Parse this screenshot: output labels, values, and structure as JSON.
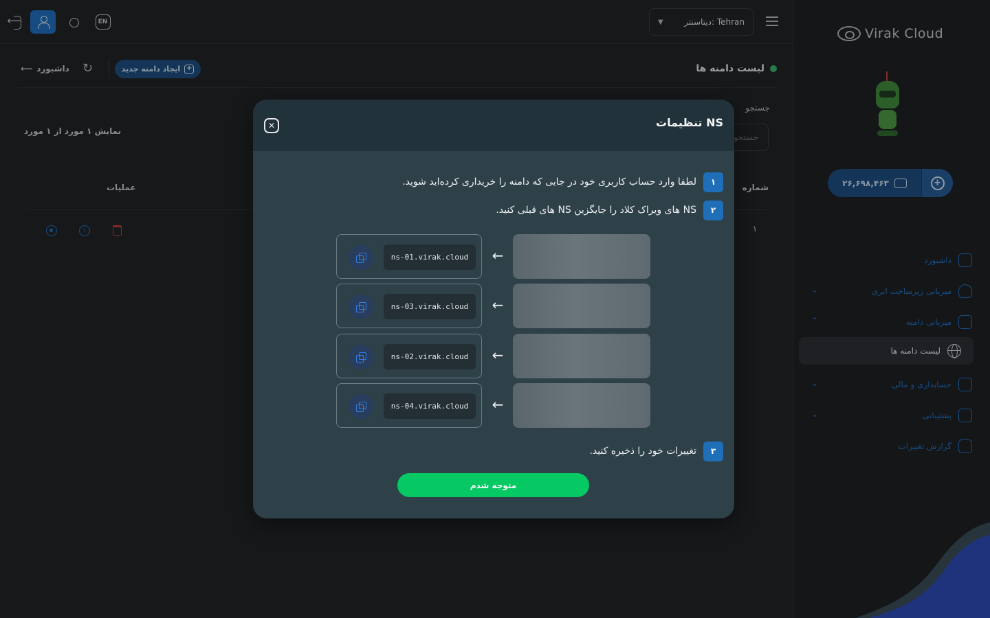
{
  "brand": {
    "name": "Virak Cloud"
  },
  "wallet": {
    "balance": "۲۶,۶۹۸,۴۶۳"
  },
  "sidebar": {
    "items": [
      {
        "label": "داشبورد",
        "icon": "home-icon",
        "expandable": false
      },
      {
        "label": "میزبانی زیرساخت ابری",
        "icon": "cloud-icon",
        "expandable": true
      },
      {
        "label": "میزبانی دامنه",
        "icon": "server-icon",
        "expandable": true,
        "expanded": true
      },
      {
        "label": "حسابداری و مالی",
        "icon": "wallet-icon",
        "expandable": true
      },
      {
        "label": "پشتیبانی",
        "icon": "support-icon",
        "expandable": true
      },
      {
        "label": "گزارش تغییرات",
        "icon": "report-icon",
        "expandable": false
      }
    ],
    "active_sub": {
      "label": "لیست دامنه ها",
      "icon": "globe-icon"
    }
  },
  "topbar": {
    "datacenter_label": "دیتاسنتر: Tehran",
    "lang": "EN"
  },
  "page": {
    "title": "لیست دامنه ها",
    "back_label": "داشبورد",
    "create_label": "ایجاد دامنه جدید",
    "search_label": "جستجو",
    "search_placeholder": "جستجو",
    "count_text": "نمایش ۱ مورد از ۱ مورد",
    "columns": {
      "operations": "عملیات",
      "number": "شماره"
    },
    "rows": [
      {
        "number": "۱"
      }
    ]
  },
  "modal": {
    "title": "تنظیمات NS",
    "steps": [
      {
        "num": "۱",
        "text": "لطفا وارد حساب کاربری خود در جایی که دامنه را خریداری کرده‌اید شوید."
      },
      {
        "num": "۲",
        "text": "NS های ویراک کلاد را جایگزین NS های قبلی کنید."
      },
      {
        "num": "۳",
        "text": "تغییرات خود را ذخیره کنید."
      }
    ],
    "nameservers": [
      "ns-01.virak.cloud",
      "ns-03.virak.cloud",
      "ns-02.virak.cloud",
      "ns-04.virak.cloud"
    ],
    "confirm_label": "متوجه شدم"
  },
  "colors": {
    "accent": "#1f6fc2",
    "success": "#06c964",
    "modal_bg": "#2e4048",
    "danger": "#c23b3b"
  }
}
